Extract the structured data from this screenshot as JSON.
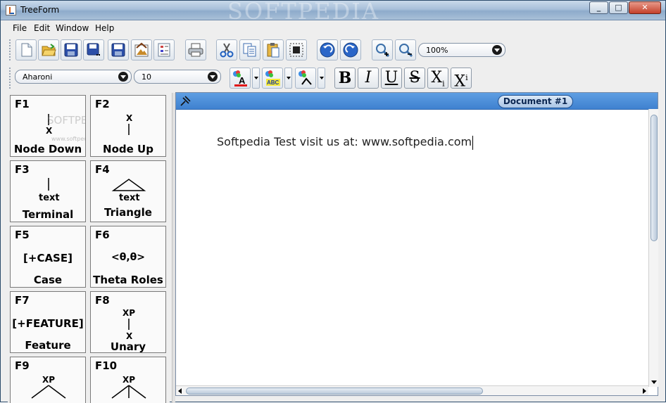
{
  "window": {
    "title": "TreeForm",
    "title_watermark": "SOFTPEDIA",
    "buttons": {
      "minimize": "_",
      "maximize": "□",
      "close": "✕"
    }
  },
  "menu": [
    "File",
    "Edit",
    "Window",
    "Help"
  ],
  "toolbar_main": {
    "icons": [
      "new-document-icon",
      "open-folder-icon",
      "save-icon",
      "save-as-icon",
      "save-all-icon",
      "export-image-icon",
      "properties-icon",
      "print-icon",
      "cut-icon",
      "copy-icon",
      "paste-icon",
      "select-icon",
      "undo-icon",
      "redo-icon",
      "zoom-in-icon",
      "zoom-out-icon"
    ],
    "zoom": "100%"
  },
  "toolbar_format": {
    "font": "Aharoni",
    "size": "10",
    "bold": "B",
    "italic": "I",
    "underline": "U",
    "strike": "S",
    "subscript": "X",
    "subscript_index": "i",
    "superscript": "X",
    "superscript_index": "i",
    "color_a": "A",
    "color_abc": "ABC"
  },
  "palette": [
    {
      "key": "F1",
      "label": "Node Down",
      "pic": "node-down",
      "text": ""
    },
    {
      "key": "F2",
      "label": "Node Up",
      "pic": "node-up",
      "text": ""
    },
    {
      "key": "F3",
      "label": "Terminal",
      "pic": "terminal",
      "text": "text"
    },
    {
      "key": "F4",
      "label": "Triangle",
      "pic": "triangle",
      "text": "text"
    },
    {
      "key": "F5",
      "label": "Case",
      "pic": "case",
      "text": "[+CASE]"
    },
    {
      "key": "F6",
      "label": "Theta Roles",
      "pic": "theta",
      "text": "<θ,θ>"
    },
    {
      "key": "F7",
      "label": "Feature",
      "pic": "feature",
      "text": "[+FEATURE]"
    },
    {
      "key": "F8",
      "label": "Unary",
      "pic": "unary",
      "text": ""
    },
    {
      "key": "F9",
      "label": "",
      "pic": "binary",
      "text": ""
    },
    {
      "key": "F10",
      "label": "",
      "pic": "binary",
      "text": ""
    }
  ],
  "pic_text": {
    "x": "X",
    "xp": "XP",
    "watermark": "SOFTPEDIA",
    "watermark_url": "www.softpedia.com"
  },
  "document": {
    "tab": "Document #1",
    "content": "Softpedia Test visit us at: www.softpedia.com"
  }
}
